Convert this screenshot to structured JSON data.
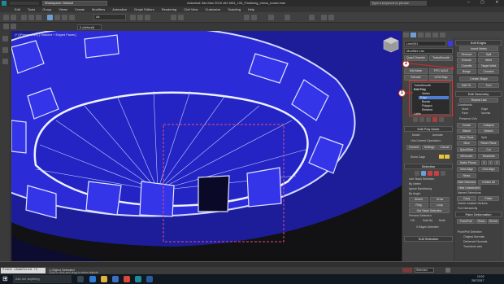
{
  "titlebar": {
    "workspace": "Workspace: Default",
    "title": "Autodesk 3ds Max 2016 x64    M04_L06_Finalising_chess_board.max",
    "search_placeholder": "Type a keyword or phrase",
    "window_buttons": "– ▢ ✕"
  },
  "menu": [
    "Edit",
    "Tools",
    "Group",
    "Views",
    "Create",
    "Modifiers",
    "Animation",
    "Graph Editors",
    "Rendering",
    "Civil View",
    "Customize",
    "Scripting",
    "Help"
  ],
  "toolbar": {
    "selection_filter": "All",
    "named_selection": "Create Selection Se",
    "layer_dropdown": "0 (default)"
  },
  "viewport": {
    "label": "[+] [Perspective] [ Shaded + Edged Faces ]",
    "colors": {
      "mesh": "#2b2bd8",
      "mesh_dark": "#1d1d9a",
      "edge": "#b9c3ff",
      "highlight": "#e6eaff",
      "background": "#121214"
    }
  },
  "command_panel": {
    "object_name": "Line001",
    "modifier_list": "Modifier List",
    "quad_chamfer": "Quad Chamfer",
    "turbosmooth_btn": "TurboSmooth",
    "edit_mesh": "Edit Mesh",
    "ffd": "FFD 2x2x2",
    "extrude": "Extrude",
    "uvw_map": "UVW Map",
    "stack": [
      "TurboSmooth",
      "Edit Poly",
      "Vertex",
      "Edge",
      "Border",
      "Polygon",
      "Element",
      "Lathe"
    ],
    "edit_poly_mode": "Edit Poly Mode",
    "model": "Model",
    "animate": "Animate",
    "no_current_op": "<No Current Operation>",
    "commit": "Commit",
    "settings": "Settings",
    "cancel": "Cancel",
    "show_cage": "Show Cage",
    "selection": "Selection",
    "use_stack_selection": "Use Stack Selection",
    "by_vertex": "By Vertex",
    "ignore_backfacing": "Ignore Backfacing",
    "by_angle": "By Angle:",
    "shrink": "Shrink",
    "grow": "Grow",
    "ring": "Ring",
    "loop": "Loop",
    "get_stack_selection": "Get Stack Selection",
    "preview_selection": "Preview Selection",
    "off": "Off",
    "subobj": "SubObj",
    "multi": "Multi",
    "edges_selected": "0 Edges Selected",
    "soft_selection": "Soft Selection"
  },
  "edit_edges": {
    "title": "Edit Edges",
    "insert_vertex": "Insert Vertex",
    "remove": "Remove",
    "split": "Split",
    "extrude": "Extrude",
    "weld": "Weld",
    "chamfer": "Chamfer",
    "target_weld": "Target Weld",
    "bridge": "Bridge",
    "connect": "Connect",
    "create_shape": "Create Shape",
    "edit_tri": "Edit Tri.",
    "turn": "Turn",
    "edit_geometry": "Edit Geometry",
    "repeat_last": "Repeat Last",
    "constraints": "Constraints",
    "none": "None",
    "edge": "Edge",
    "face": "Face",
    "normal": "Normal",
    "preserve_uvs": "Preserve UVs",
    "create": "Create",
    "collapse": "Collapse",
    "attach": "Attach",
    "detach": "Detach",
    "slice_plane": "Slice Plane",
    "split_label": "Split",
    "slice": "Slice",
    "reset_plane": "Reset Plane",
    "quickslice": "QuickSlice",
    "cut": "Cut",
    "msmooth": "MSmooth",
    "tessellate": "Tessellate",
    "make_planar": "Make Planar",
    "x": "X",
    "y": "Y",
    "z": "Z",
    "view_align": "View Align",
    "grid_align": "Grid Align",
    "relax": "Relax",
    "hide_selected": "Hide Selected",
    "unhide_all": "Unhide All",
    "hide_unselected": "Hide Unselected",
    "named_selections": "Named Selections:",
    "copy": "Copy",
    "paste": "Paste",
    "delete_isolated": "Delete Isolated Vertices",
    "full_interactivity": "Full Interactivity",
    "paint_deformation": "Paint Deformation",
    "push_pull": "Push/Pull",
    "relax_btn": "Relax",
    "revert": "Revert",
    "push_pull_direction": "Push/Pull Direction",
    "original_normals": "Original Normals",
    "deformed_normals": "Deformed Normals",
    "transform_axis": "Transform axis"
  },
  "callouts": [
    "1",
    "2"
  ],
  "status": {
    "maxscript": "front chamfered +1",
    "objects_selected": "1 Object Selected",
    "prompt": "Click or click-and-drag to select objects",
    "selected": "Selected",
    "time": "19:02",
    "date": "25/7/2017"
  },
  "taskbar": {
    "search_placeholder": "Ask me anything"
  }
}
